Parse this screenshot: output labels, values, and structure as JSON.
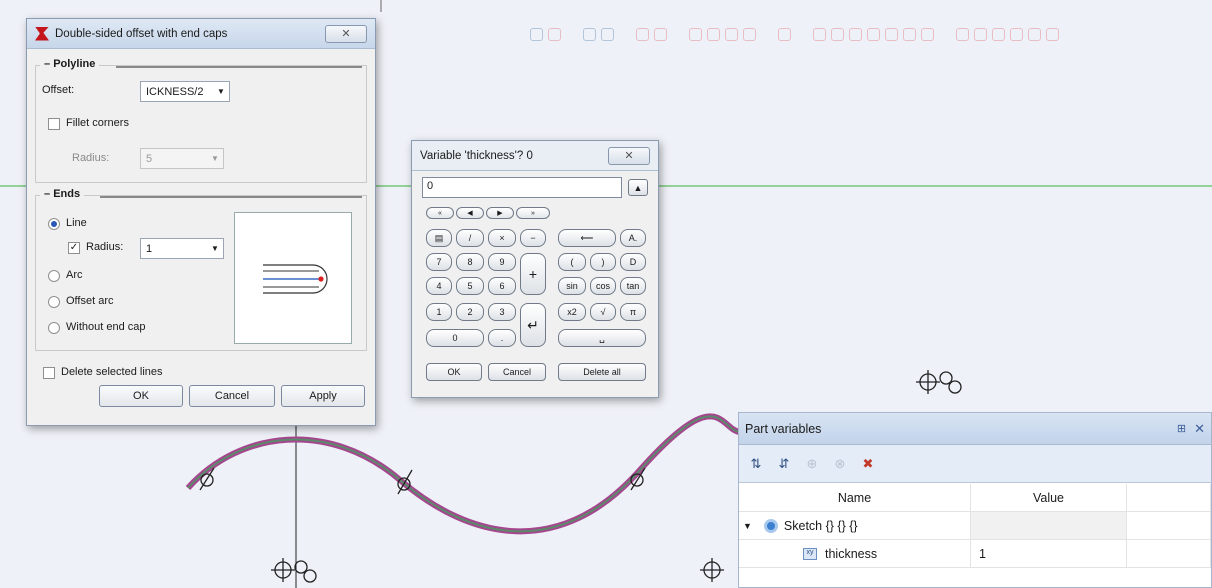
{
  "offset_dialog": {
    "title": "Double-sided offset with end caps",
    "close_label": "✕",
    "polyline": {
      "heading": "Polyline",
      "offset_label": "Offset:",
      "offset_value": "ICKNESS/2",
      "fillet_label": "Fillet corners",
      "radius_label": "Radius:",
      "radius_value": "5"
    },
    "ends": {
      "heading": "Ends",
      "line_label": "Line",
      "radius_label": "Radius:",
      "radius_value": "1",
      "arc_label": "Arc",
      "offset_arc_label": "Offset arc",
      "without_cap_label": "Without end cap"
    },
    "delete_label": "Delete selected lines",
    "ok_label": "OK",
    "cancel_label": "Cancel",
    "apply_label": "Apply"
  },
  "calculator": {
    "title": "Variable 'thickness'? 0",
    "close_label": "✕",
    "input_value": "0",
    "nav": [
      "«",
      "◀",
      "▶",
      "»"
    ],
    "keys": {
      "k7": "7",
      "k8": "8",
      "k9": "9",
      "k4": "4",
      "k5": "5",
      "k6": "6",
      "k1": "1",
      "k2": "2",
      "k3": "3",
      "k0": "0",
      "dot": ".",
      "plus": "+",
      "enter": "↵",
      "div": "/",
      "mul": "×",
      "minus": "−",
      "back": "⟵",
      "a": "A.",
      "lp": "(",
      "rp": ")",
      "d": "D",
      "sin": "sin",
      "cos": "cos",
      "tan": "tan",
      "x2": "x2",
      "sqrt": "√",
      "pi": "π",
      "space": "␣"
    },
    "ok_label": "OK",
    "cancel_label": "Cancel",
    "delete_all_label": "Delete all"
  },
  "part_variables": {
    "title": "Part variables",
    "pin_icon": "pin-icon",
    "columns": [
      "Name",
      "Value"
    ],
    "rows": [
      {
        "name": "Sketch {} {} {}",
        "value": ""
      },
      {
        "name": "thickness",
        "value": "1"
      }
    ]
  },
  "colors": {
    "background": "#eef1f7",
    "guide_line": "#5cbf5c",
    "curve_outer": "#a5468f",
    "curve_inner": "#5a8a6a",
    "accent": "#2b57b8"
  }
}
